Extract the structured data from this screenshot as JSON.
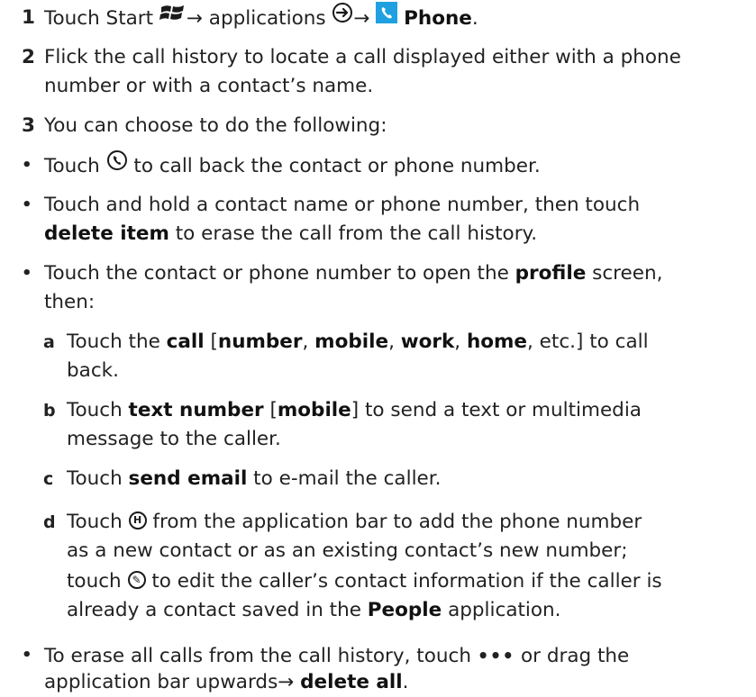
{
  "accent_color": "#1fa1e1",
  "steps": [
    {
      "num": "1",
      "pre": "Touch Start",
      "icon1": "windows-start-icon",
      "arrow1": "→",
      "mid": " applications",
      "icon2": "circle-arrow-icon",
      "arrow2": "→",
      "icon3": "phone-tile-icon",
      "bold": "Phone",
      "end": "."
    },
    {
      "num": "2",
      "line1": "Flick the call history to locate a call displayed either with a phone",
      "line2": "number or with a contact’s name."
    },
    {
      "num": "3",
      "text": "You can choose to do the following:"
    }
  ],
  "bullet": "•",
  "bullets": [
    {
      "pre": "Touch",
      "icon": "call-back-icon",
      "post": "to call back the contact or phone number."
    },
    {
      "line1": "Touch and hold a contact name or phone number, then touch",
      "bold": "delete item",
      "rest": " to erase the call from the call history."
    },
    {
      "pre": "Touch the contact or phone number to open the ",
      "bold": "profile",
      "post": " screen,",
      "line2": "then:"
    },
    {
      "pre": "To erase all calls from the call history, touch",
      "icon": "more-dots-icon",
      "dots": "•••",
      "post": "or drag the",
      "line2_pre": "application bar upwards",
      "arrow": "→",
      "bold": "delete all",
      "end": "."
    }
  ],
  "subitems": {
    "a": {
      "letter": "a",
      "pre": "Touch the ",
      "b1": "call",
      "br1": " [",
      "b2": "number",
      "c1": ", ",
      "b3": "mobile",
      "c2": ", ",
      "b4": "work",
      "c3": ", ",
      "b5": "home",
      "post": ", etc.] to call",
      "line2": "back."
    },
    "b": {
      "letter": "b",
      "pre": "Touch ",
      "b1": "text number",
      "br1": " [",
      "b2": "mobile",
      "post": "] to send a text or multimedia",
      "line2": "message to the caller."
    },
    "c": {
      "letter": "c",
      "pre": "Touch ",
      "b1": "send email",
      "post": " to e-mail the caller."
    },
    "d": {
      "letter": "d",
      "pre": "Touch",
      "icon1": "save-contact-icon",
      "icon1_glyph": "H",
      "post1": "from the application bar to add the phone number",
      "line2": "as a new contact or as an existing contact’s new number;",
      "line3_pre": "touch",
      "icon2": "edit-icon",
      "icon2_glyph": "✎",
      "line3_post": "to edit the caller’s contact information if the caller is",
      "line4_pre": "already a contact saved in the ",
      "b1": "People",
      "line4_post": " application."
    }
  }
}
